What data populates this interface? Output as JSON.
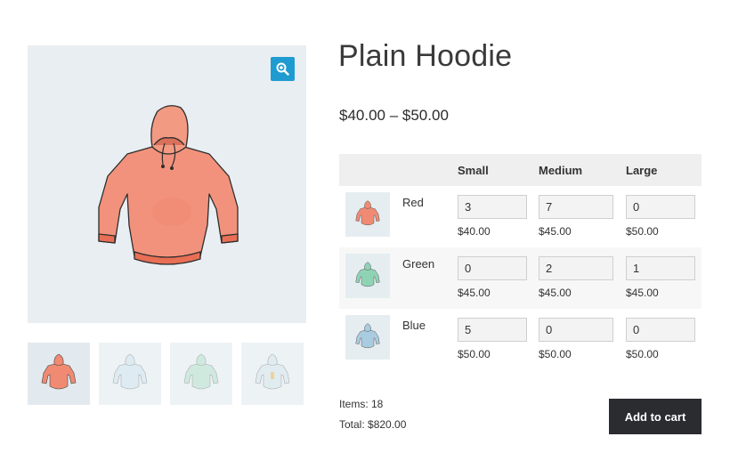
{
  "product": {
    "title": "Plain Hoodie",
    "price_range": "$40.00 – $50.00"
  },
  "gallery": {
    "zoom_icon": "magnifier-plus-icon",
    "thumbnails": [
      {
        "color": "#f08a73",
        "name": "red-hoodie"
      },
      {
        "color": "#b9d9ea",
        "name": "blue-hoodie"
      },
      {
        "color": "#a8dcc3",
        "name": "green-hoodie"
      },
      {
        "color": "#c9dfe6",
        "name": "hoodie-with-logo"
      }
    ]
  },
  "variations": {
    "columns": [
      "Small",
      "Medium",
      "Large"
    ],
    "rows": [
      {
        "label": "Red",
        "swatch": "#f08a73",
        "cells": [
          {
            "qty": "3",
            "price": "$40.00"
          },
          {
            "qty": "7",
            "price": "$45.00"
          },
          {
            "qty": "0",
            "price": "$50.00"
          }
        ]
      },
      {
        "label": "Green",
        "swatch": "#8fd3b5",
        "cells": [
          {
            "qty": "0",
            "price": "$45.00"
          },
          {
            "qty": "2",
            "price": "$45.00"
          },
          {
            "qty": "1",
            "price": "$45.00"
          }
        ]
      },
      {
        "label": "Blue",
        "swatch": "#a9cce0",
        "cells": [
          {
            "qty": "5",
            "price": "$50.00"
          },
          {
            "qty": "0",
            "price": "$50.00"
          },
          {
            "qty": "0",
            "price": "$50.00"
          }
        ]
      }
    ]
  },
  "summary": {
    "items": "Items: 18",
    "total": "Total: $820.00",
    "add_to_cart": "Add to cart"
  },
  "colors": {
    "accent": "#1e9bd0",
    "button": "#2a2c30",
    "image_bg": "#e8eef2"
  }
}
